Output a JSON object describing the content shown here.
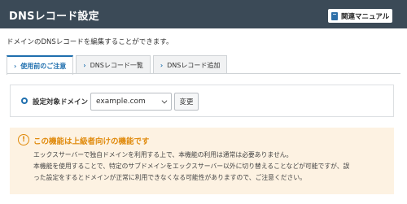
{
  "header": {
    "title": "DNSレコード設定",
    "manual_button": "関連マニュアル"
  },
  "intro_text": "ドメインのDNSレコードを編集することができます。",
  "tabs": [
    {
      "label": "使用前のご注意",
      "active": true
    },
    {
      "label": "DNSレコード一覧",
      "active": false
    },
    {
      "label": "DNSレコード追加",
      "active": false
    }
  ],
  "domain_selector": {
    "label": "設定対象ドメイン",
    "selected": "example.com",
    "change_button": "変更"
  },
  "warning": {
    "icon": "!",
    "title": "この機能は上級者向けの機能です",
    "lines": [
      "エックスサーバーで独自ドメインを利用する上で、本機能の利用は通常は必要ありません。",
      "本機能を使用することで、特定のサブドメインをエックスサーバー以外に切り替えることなどが可能ですが、誤",
      "った設定をするとドメインが正常に利用できなくなる可能性がありますので、ご注意ください。"
    ]
  },
  "colors": {
    "header_bg": "#3b4a57",
    "accent": "#1f6fae",
    "warning_bg": "#fdf2e2",
    "warning_text": "#e08a0c"
  }
}
